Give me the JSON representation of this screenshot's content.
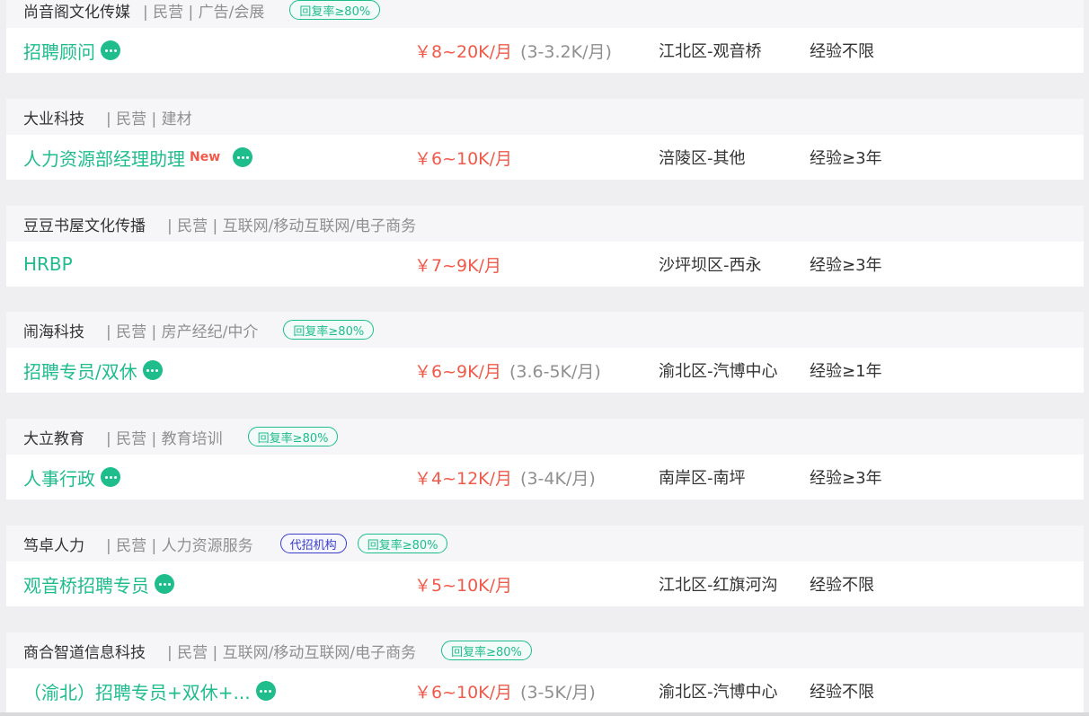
{
  "listings": [
    {
      "company": "尚音阁文化传媒",
      "meta": "| 民营 | 广告/会展",
      "badges": [
        "回复率≥80%"
      ],
      "title": "招聘顾问",
      "new": "",
      "salary": "￥8~20K/月",
      "salary_sub": "(3-3.2K/月)",
      "location": "江北区-观音桥",
      "experience": "经验不限"
    },
    {
      "company": "大业科技",
      "meta": "| 民营 | 建材",
      "badges": [],
      "title": "人力资源部经理助理",
      "new": "New",
      "salary": "￥6~10K/月",
      "salary_sub": "",
      "location": "涪陵区-其他",
      "experience": "经验≥3年"
    },
    {
      "company": "豆豆书屋文化传播",
      "meta": "| 民营 | 互联网/移动互联网/电子商务",
      "badges": [],
      "title": "HRBP",
      "new": "",
      "salary": "￥7~9K/月",
      "salary_sub": "",
      "location": "沙坪坝区-西永",
      "experience": "经验≥3年"
    },
    {
      "company": "闹海科技",
      "meta": "| 民营 | 房产经纪/中介",
      "badges": [
        "回复率≥80%"
      ],
      "title": "招聘专员/双休",
      "new": "",
      "salary": "￥6~9K/月",
      "salary_sub": "(3.6-5K/月)",
      "location": "渝北区-汽博中心",
      "experience": "经验≥1年"
    },
    {
      "company": "大立教育",
      "meta": "| 民营 | 教育培训",
      "badges": [
        "回复率≥80%"
      ],
      "title": "人事行政",
      "new": "",
      "salary": "￥4~12K/月",
      "salary_sub": "(3-4K/月)",
      "location": "南岸区-南坪",
      "experience": "经验≥3年"
    },
    {
      "company": "笃卓人力",
      "meta": "| 民营 | 人力资源服务",
      "badges": [
        "代招机构",
        "回复率≥80%"
      ],
      "title": "观音桥招聘专员",
      "new": "",
      "salary": "￥5~10K/月",
      "salary_sub": "",
      "location": "江北区-红旗河沟",
      "experience": "经验不限"
    },
    {
      "company": "商合智道信息科技",
      "meta": "| 民营 | 互联网/移动互联网/电子商务",
      "badges": [
        "回复率≥80%"
      ],
      "title": "（渝北）招聘专员+双休+...",
      "new": "",
      "salary": "￥6~10K/月",
      "salary_sub": "(3-5K/月)",
      "location": "渝北区-汽博中心",
      "experience": "经验不限"
    }
  ],
  "icons": {
    "chat": "chat-bubble-icon"
  },
  "colors": {
    "accent": "#1fbc8c",
    "salary": "#f05a4a",
    "agent": "#3b3ec9"
  }
}
